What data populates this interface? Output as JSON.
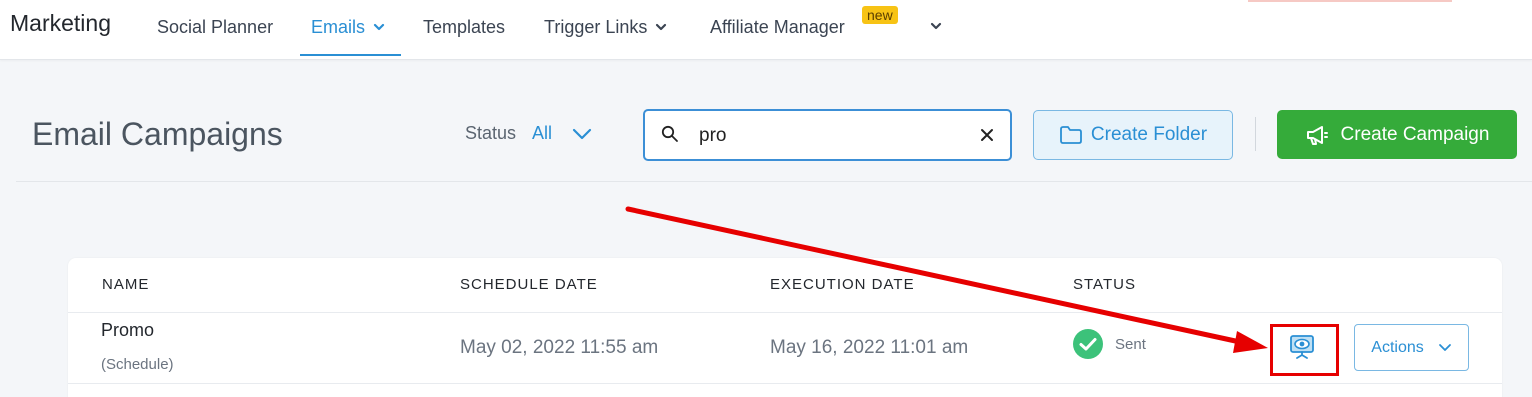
{
  "nav": {
    "brand": "Marketing",
    "items": [
      {
        "label": "Social Planner"
      },
      {
        "label": "Emails"
      },
      {
        "label": "Templates"
      },
      {
        "label": "Trigger Links"
      },
      {
        "label": "Affiliate Manager"
      }
    ],
    "new_badge": "new"
  },
  "header": {
    "title": "Email Campaigns",
    "status_label": "Status",
    "status_value": "All",
    "search_value": "pro",
    "create_folder": "Create Folder",
    "create_campaign": "Create Campaign"
  },
  "table": {
    "columns": [
      "NAME",
      "SCHEDULE DATE",
      "EXECUTION DATE",
      "STATUS"
    ],
    "rows": [
      {
        "name": "Promo",
        "type": "(Schedule)",
        "schedule_date": "May 02, 2022 11:55 am",
        "execution_date": "May 16, 2022 11:01 am",
        "status": "Sent",
        "actions": "Actions"
      }
    ]
  },
  "colors": {
    "accent": "#2a8fd4",
    "success": "#35ab3a",
    "annotation": "#e60000",
    "badge": "#f7c315"
  }
}
